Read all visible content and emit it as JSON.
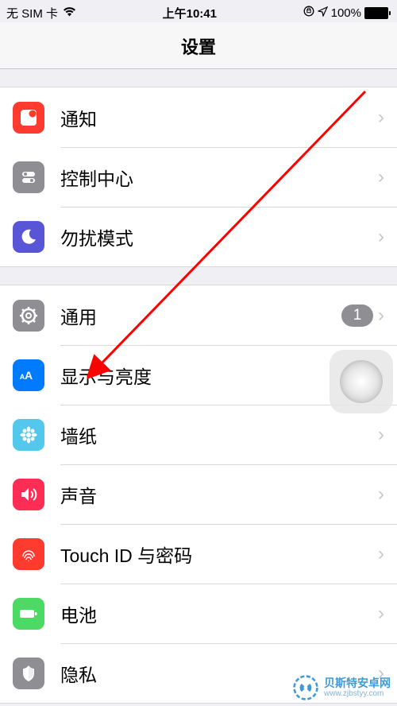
{
  "status_bar": {
    "carrier": "无 SIM 卡",
    "time": "上午10:41",
    "battery_pct": "100%"
  },
  "header": {
    "title": "设置"
  },
  "groups": [
    {
      "rows": [
        {
          "key": "notifications",
          "label": "通知",
          "icon": "notifications-icon",
          "color": "#ff3b30"
        },
        {
          "key": "control-center",
          "label": "控制中心",
          "icon": "control-center-icon",
          "color": "#8e8e93"
        },
        {
          "key": "dnd",
          "label": "勿扰模式",
          "icon": "dnd-icon",
          "color": "#5856d6"
        }
      ]
    },
    {
      "rows": [
        {
          "key": "general",
          "label": "通用",
          "icon": "general-icon",
          "color": "#8e8e93",
          "badge": "1"
        },
        {
          "key": "display-brightness",
          "label": "显示与亮度",
          "icon": "display-icon",
          "color": "#007aff"
        },
        {
          "key": "wallpaper",
          "label": "墙纸",
          "icon": "wallpaper-icon",
          "color": "#54c7ec"
        },
        {
          "key": "sounds",
          "label": "声音",
          "icon": "sounds-icon",
          "color": "#ff2d55"
        },
        {
          "key": "touch-id",
          "label": "Touch ID 与密码",
          "icon": "touchid-icon",
          "color": "#ff3b30"
        },
        {
          "key": "battery",
          "label": "电池",
          "icon": "battery-icon",
          "color": "#4cd964"
        },
        {
          "key": "privacy",
          "label": "隐私",
          "icon": "privacy-icon",
          "color": "#8e8e93"
        }
      ]
    }
  ],
  "watermark": {
    "brand": "贝斯特安卓网",
    "url": "www.zjbstyy.com"
  }
}
